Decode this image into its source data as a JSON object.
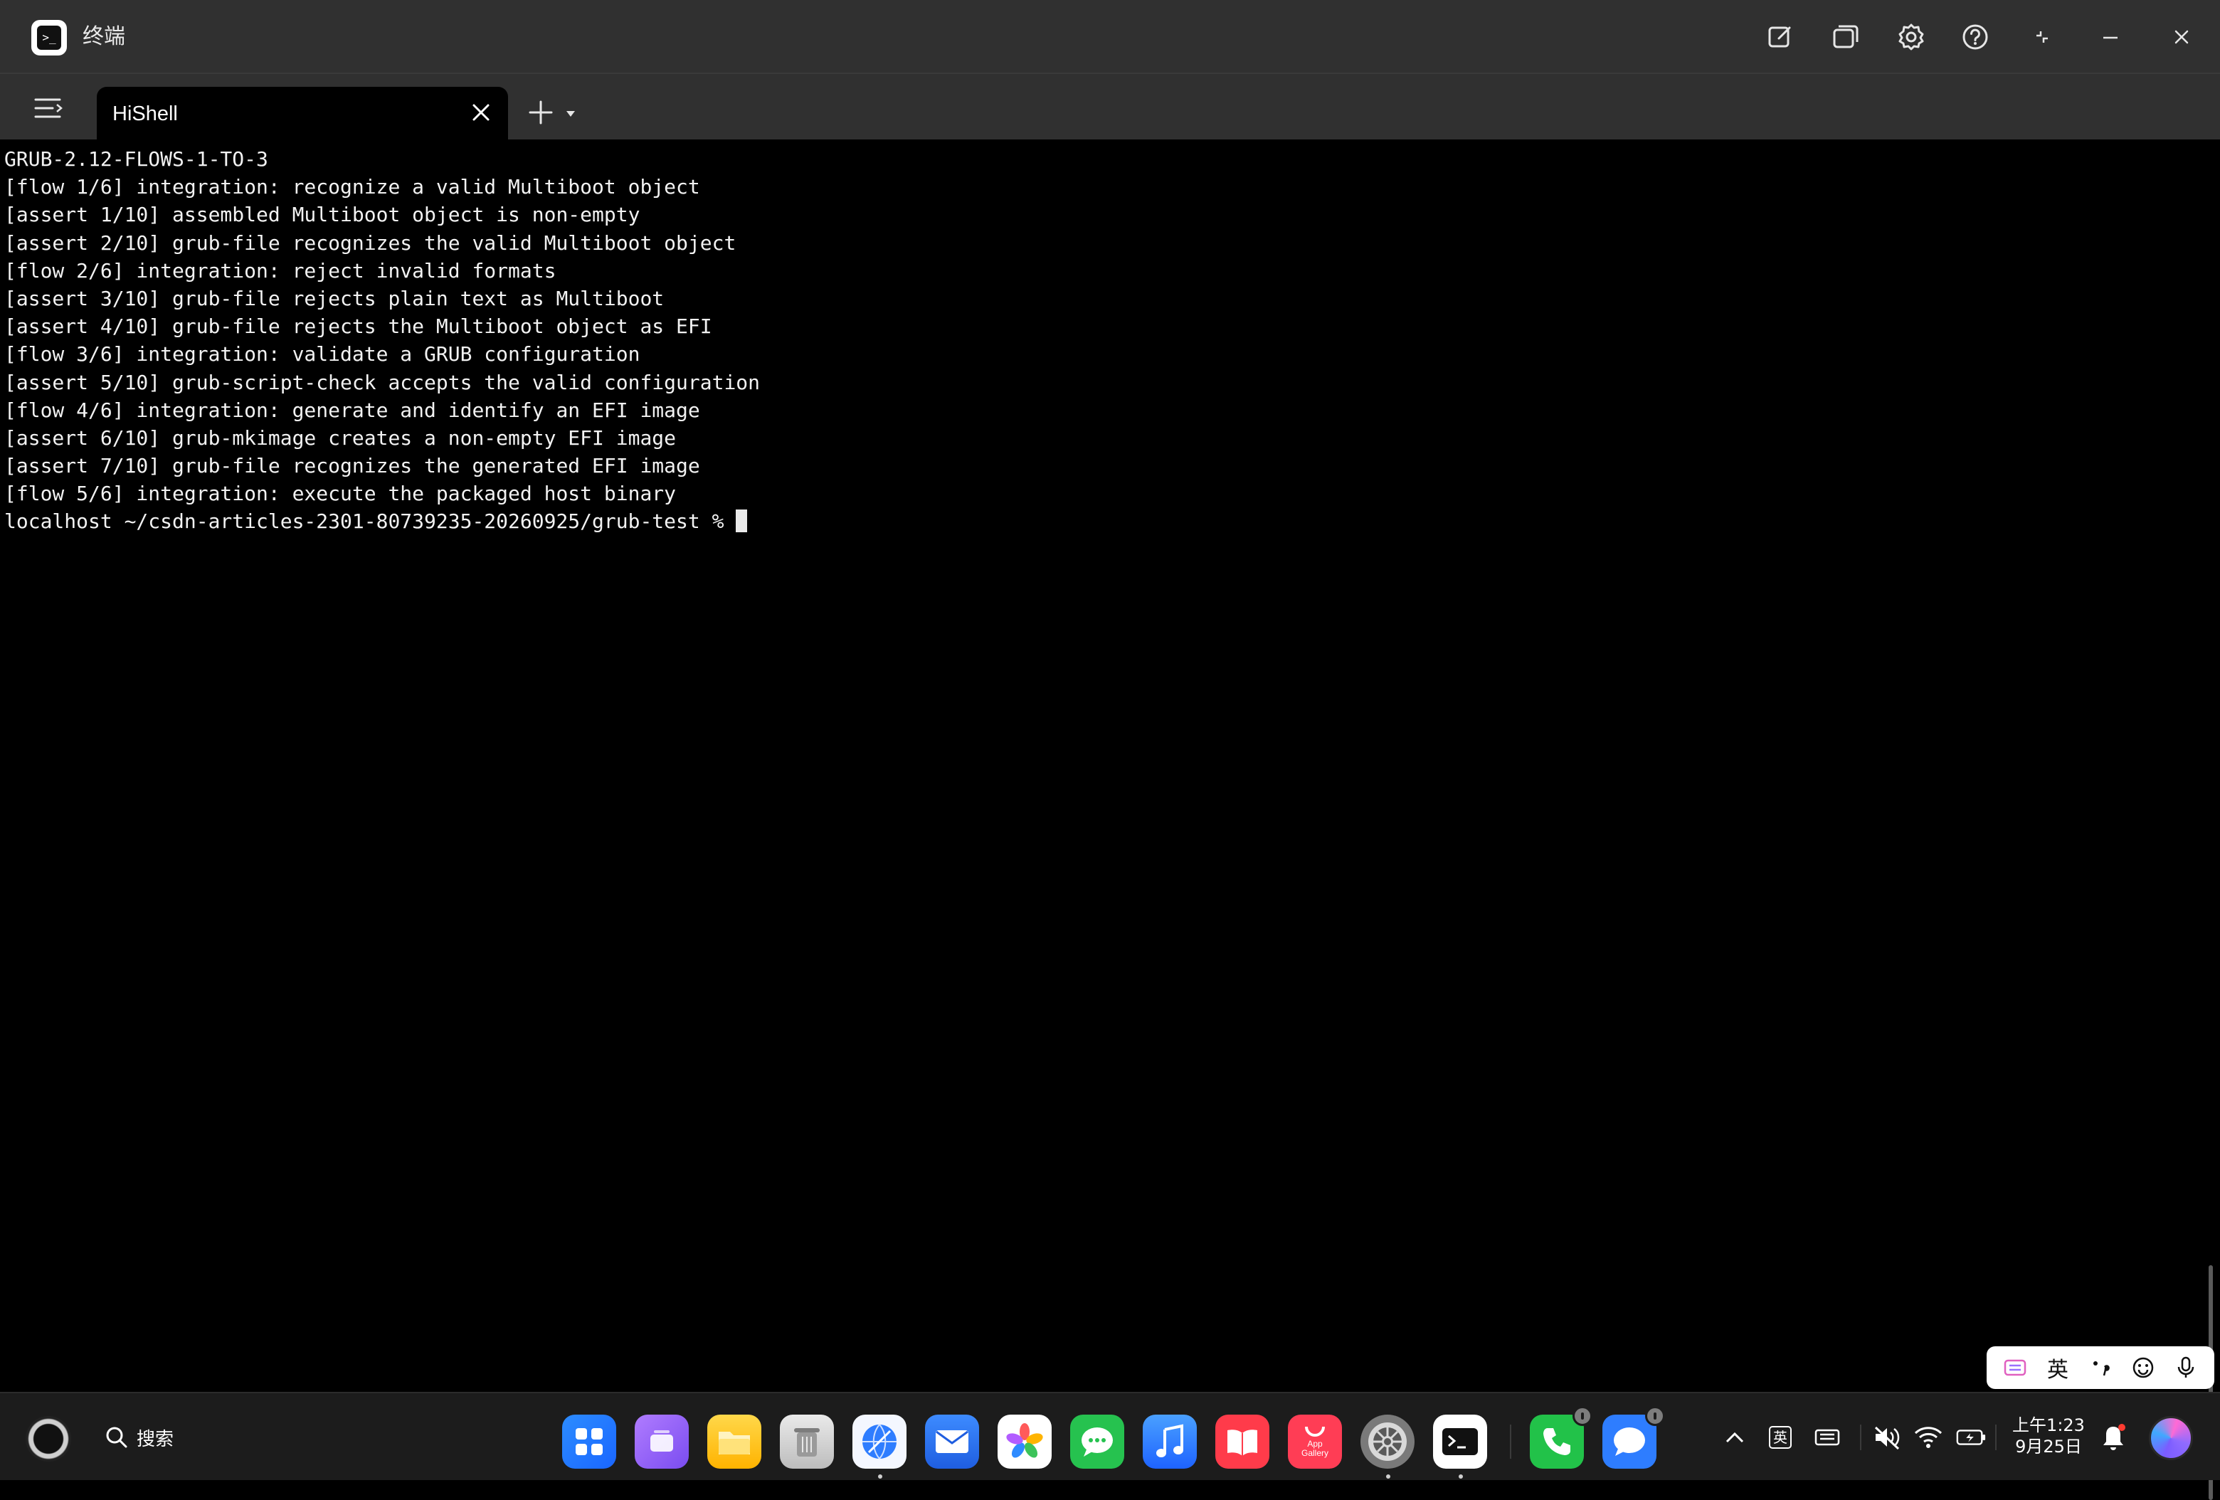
{
  "window": {
    "app_title": "终端",
    "app_icon_glyph": ">_"
  },
  "tabs": [
    {
      "label": "HiShell",
      "active": true
    }
  ],
  "terminal": {
    "lines": [
      "GRUB-2.12-FLOWS-1-TO-3",
      "[flow 1/6] integration: recognize a valid Multiboot object",
      "[assert 1/10] assembled Multiboot object is non-empty",
      "[assert 2/10] grub-file recognizes the valid Multiboot object",
      "[flow 2/6] integration: reject invalid formats",
      "[assert 3/10] grub-file rejects plain text as Multiboot",
      "[assert 4/10] grub-file rejects the Multiboot object as EFI",
      "[flow 3/6] integration: validate a GRUB configuration",
      "[assert 5/10] grub-script-check accepts the valid configuration",
      "[flow 4/6] integration: generate and identify an EFI image",
      "[assert 6/10] grub-mkimage creates a non-empty EFI image",
      "[assert 7/10] grub-file recognizes the generated EFI image",
      "[flow 5/6] integration: execute the packaged host binary"
    ],
    "prompt": "localhost ~/csdn-articles-2301-80739235-20260925/grub-test % "
  },
  "ime": {
    "language_label": "英"
  },
  "taskbar": {
    "search_label": "搜索",
    "appgallery_label": "App\nGallery",
    "tray_input_label": "英",
    "clock_time": "上午1:23",
    "clock_date": "9月25日"
  },
  "colors": {
    "titlebar_bg": "#303030",
    "terminal_bg": "#000000",
    "terminal_fg": "#f2f2f2",
    "dock_bg": "#1c1c1c"
  }
}
